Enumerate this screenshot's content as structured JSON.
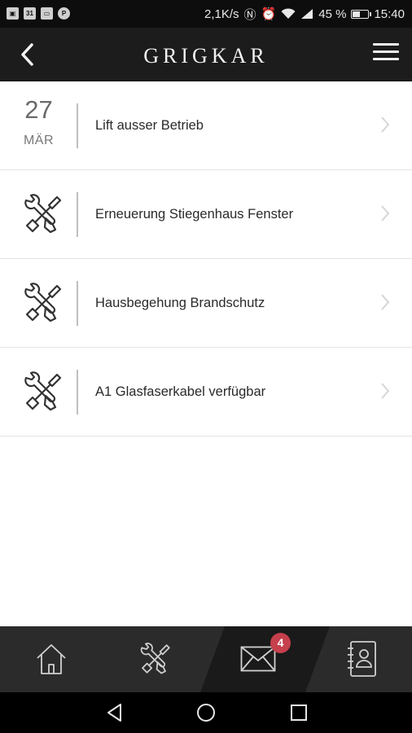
{
  "status_bar": {
    "left_icons": [
      "image-icon",
      "calendar-icon",
      "tv-icon",
      "pinterest-icon"
    ],
    "calendar_day": "31",
    "network_speed": "2,1K/s",
    "battery": "45 %",
    "battery_level": 0.45,
    "time": "15:40"
  },
  "header": {
    "title": "GRIGKAR",
    "back_icon": "chevron-left-icon",
    "menu_icon": "hamburger-menu-icon"
  },
  "items": [
    {
      "type": "date",
      "day": "27",
      "month": "MÄR",
      "title": "Lift ausser Betrieb"
    },
    {
      "type": "tools",
      "icon": "tools-icon",
      "title": "Erneuerung Stiegenhaus Fenster"
    },
    {
      "type": "tools",
      "icon": "tools-icon",
      "title": "Hausbegehung Brandschutz"
    },
    {
      "type": "tools",
      "icon": "tools-icon",
      "title": "A1 Glasfaserkabel verfügbar"
    }
  ],
  "bottom_nav": {
    "items": [
      {
        "name": "home",
        "icon": "home-icon"
      },
      {
        "name": "repairs",
        "icon": "tools-icon"
      },
      {
        "name": "messages",
        "icon": "mail-icon",
        "badge": "4",
        "active": true
      },
      {
        "name": "contacts",
        "icon": "contacts-book-icon"
      }
    ]
  },
  "colors": {
    "header_bg": "#1c1c1c",
    "nav_bg": "#2b2b2b",
    "nav_active_bg": "#1a1a1a",
    "badge": "#c63f4c"
  }
}
